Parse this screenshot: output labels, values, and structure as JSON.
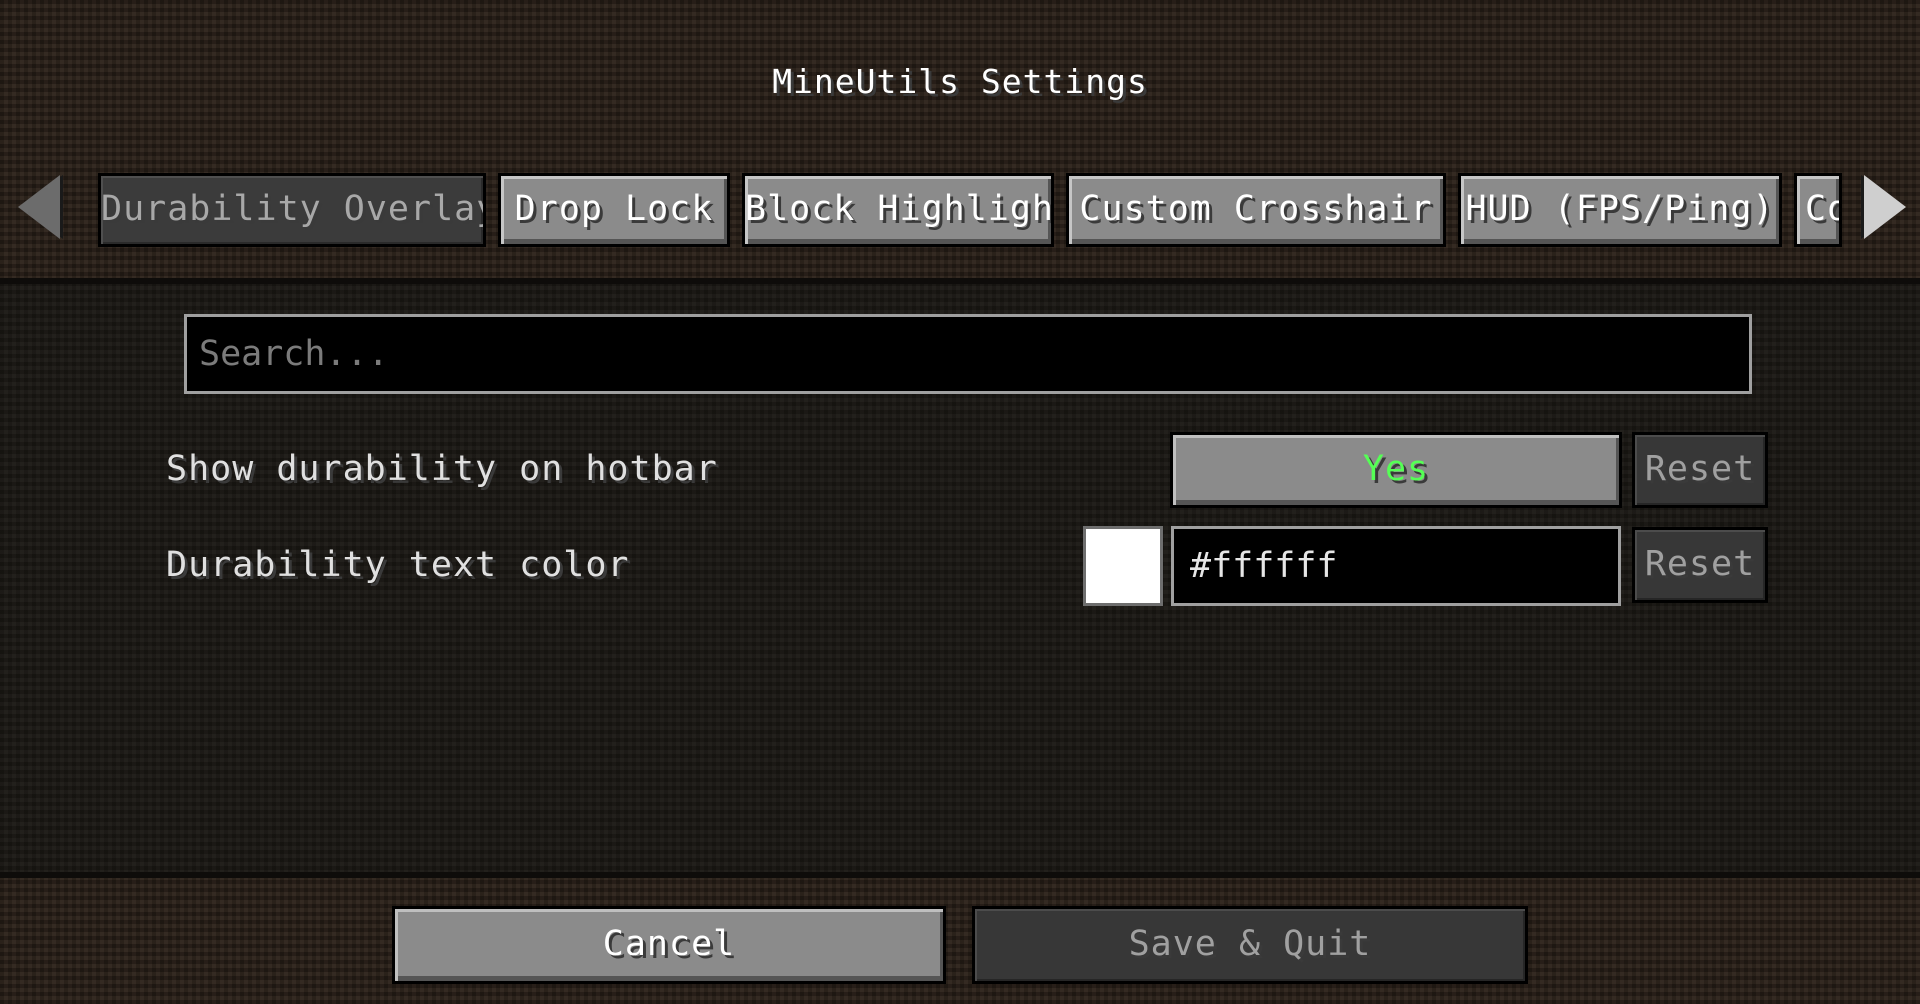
{
  "window": {
    "title": "MineUtils Settings"
  },
  "tabs": [
    {
      "label": "Durability Overlay",
      "active": true
    },
    {
      "label": "Drop Lock",
      "active": false
    },
    {
      "label": "Block Highlight",
      "active": false
    },
    {
      "label": "Custom Crosshair",
      "active": false
    },
    {
      "label": "HUD (FPS/Ping)",
      "active": false
    },
    {
      "label": "Co",
      "active": false
    }
  ],
  "icons": {
    "scroll_left": "arrow-left-icon",
    "scroll_right": "arrow-right-icon"
  },
  "search": {
    "placeholder": "Search...",
    "value": ""
  },
  "settings": [
    {
      "label": "Show durability on hotbar",
      "value": "Yes",
      "value_color": "#55ff55",
      "reset_label": "Reset"
    },
    {
      "label": "Durability text color",
      "value": "#ffffff",
      "swatch_color": "#ffffff",
      "reset_label": "Reset"
    }
  ],
  "footer": {
    "cancel_label": "Cancel",
    "save_label": "Save & Quit"
  },
  "colors": {
    "background": "#2b2119",
    "panel": "#1c1915",
    "button": "#8b8b8b",
    "button_disabled": "#373737",
    "yes_green": "#55ff55"
  }
}
